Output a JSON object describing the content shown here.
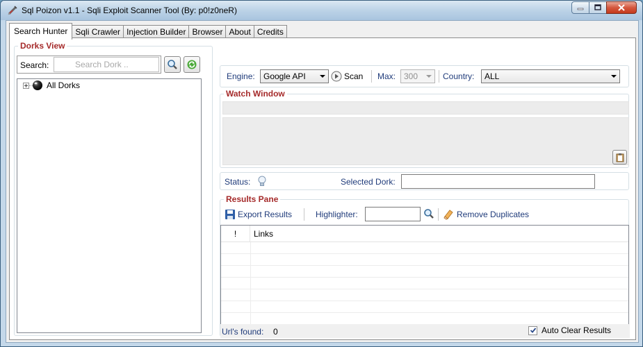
{
  "window": {
    "title": "Sql Poizon v1.1 - Sqli Exploit Scanner Tool (By: p0!z0neR)"
  },
  "tabs": [
    {
      "label": "Search Hunter",
      "active": true
    },
    {
      "label": "Sqli Crawler"
    },
    {
      "label": "Injection Builder"
    },
    {
      "label": "Browser"
    },
    {
      "label": "About"
    },
    {
      "label": "Credits"
    }
  ],
  "dorks_view": {
    "legend": "Dorks View",
    "search_label": "Search:",
    "search_placeholder": "Search Dork ..",
    "tree_root": "All Dorks"
  },
  "toolbar": {
    "engine_label": "Engine:",
    "engine_value": "Google API",
    "scan_label": "Scan",
    "max_label": "Max:",
    "max_value": "300",
    "country_label": "Country:",
    "country_value": "ALL"
  },
  "watch_window": {
    "legend": "Watch Window"
  },
  "status": {
    "status_label": "Status:",
    "selected_dork_label": "Selected Dork:",
    "selected_dork_value": ""
  },
  "results": {
    "legend": "Results Pane",
    "export_label": "Export Results",
    "highlighter_label": "Highlighter:",
    "highlighter_value": "",
    "remove_duplicates_label": "Remove Duplicates",
    "columns": [
      "!",
      "Links"
    ]
  },
  "footer": {
    "urls_found_label": "Url's found:",
    "urls_found_value": "0",
    "auto_clear_label": "Auto Clear Results",
    "auto_clear_checked": true
  },
  "colors": {
    "legend": "#a52a2a",
    "label": "#1f3b7a"
  }
}
